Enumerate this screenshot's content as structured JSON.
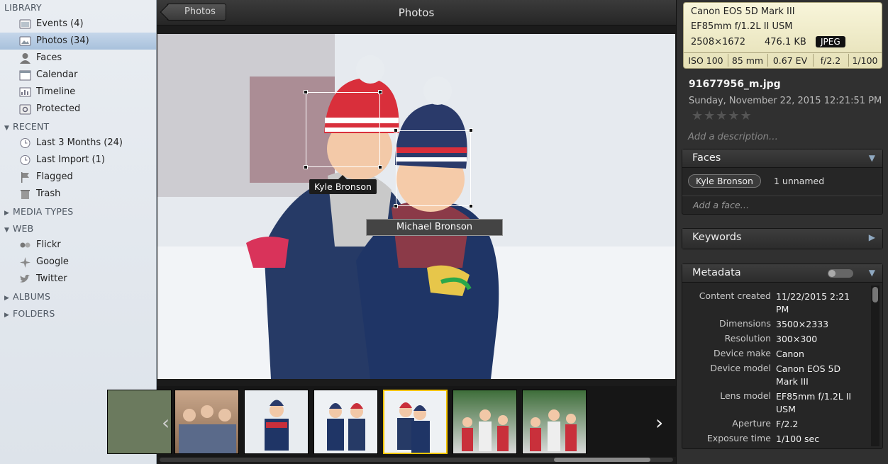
{
  "sidebar": {
    "sections": {
      "library": "LIBRARY",
      "recent": "RECENT",
      "media_types": "MEDIA TYPES",
      "web": "WEB",
      "albums": "ALBUMS",
      "folders": "FOLDERS"
    },
    "library_items": [
      {
        "label": "Events (4)",
        "icon": "events-icon"
      },
      {
        "label": "Photos (34)",
        "icon": "photos-icon",
        "selected": true
      },
      {
        "label": "Faces",
        "icon": "faces-icon"
      },
      {
        "label": "Calendar",
        "icon": "calendar-icon"
      },
      {
        "label": "Timeline",
        "icon": "timeline-icon"
      },
      {
        "label": "Protected",
        "icon": "protected-icon"
      }
    ],
    "recent_items": [
      {
        "label": "Last 3 Months (24)",
        "icon": "clock-icon"
      },
      {
        "label": "Last Import (1)",
        "icon": "clock-icon"
      },
      {
        "label": "Flagged",
        "icon": "flag-icon"
      },
      {
        "label": "Trash",
        "icon": "trash-icon"
      }
    ],
    "web_items": [
      {
        "label": "Flickr",
        "icon": "flickr-icon"
      },
      {
        "label": "Google",
        "icon": "google-icon"
      },
      {
        "label": "Twitter",
        "icon": "twitter-icon"
      }
    ]
  },
  "toolbar": {
    "back_label": "Photos",
    "title": "Photos"
  },
  "viewer": {
    "face_tag_1": "Kyle Bronson",
    "face_tag_2_input": "Michael Bronson"
  },
  "inspector": {
    "exif": {
      "camera": "Canon EOS 5D Mark III",
      "lens": "EF85mm f/1.2L II USM",
      "resolution": "2508×1672",
      "size": "476.1 KB",
      "format": "JPEG",
      "iso": "ISO 100",
      "focal": "85 mm",
      "ev": "0.67 EV",
      "aperture": "f/2.2",
      "shutter": "1/100"
    },
    "filename": "91677956_m.jpg",
    "date": "Sunday, November 22, 2015 12:21:51 PM",
    "rating_stars": "★★★★★",
    "description_placeholder": "Add a description…",
    "faces": {
      "title": "Faces",
      "named": "Kyle Bronson",
      "unnamed": "1 unnamed",
      "add": "Add a face…"
    },
    "keywords": {
      "title": "Keywords"
    },
    "metadata": {
      "title": "Metadata",
      "rows": [
        {
          "key": "Content created",
          "value": "11/22/2015 2:21 PM"
        },
        {
          "key": "Dimensions",
          "value": "3500×2333"
        },
        {
          "key": "Resolution",
          "value": "300×300"
        },
        {
          "key": "Device make",
          "value": "Canon"
        },
        {
          "key": "Device model",
          "value": "Canon EOS 5D Mark III"
        },
        {
          "key": "Lens model",
          "value": "EF85mm f/1.2L II USM"
        },
        {
          "key": "Aperture",
          "value": "F/2.2"
        },
        {
          "key": "Exposure time",
          "value": "1/100 sec"
        }
      ]
    }
  }
}
